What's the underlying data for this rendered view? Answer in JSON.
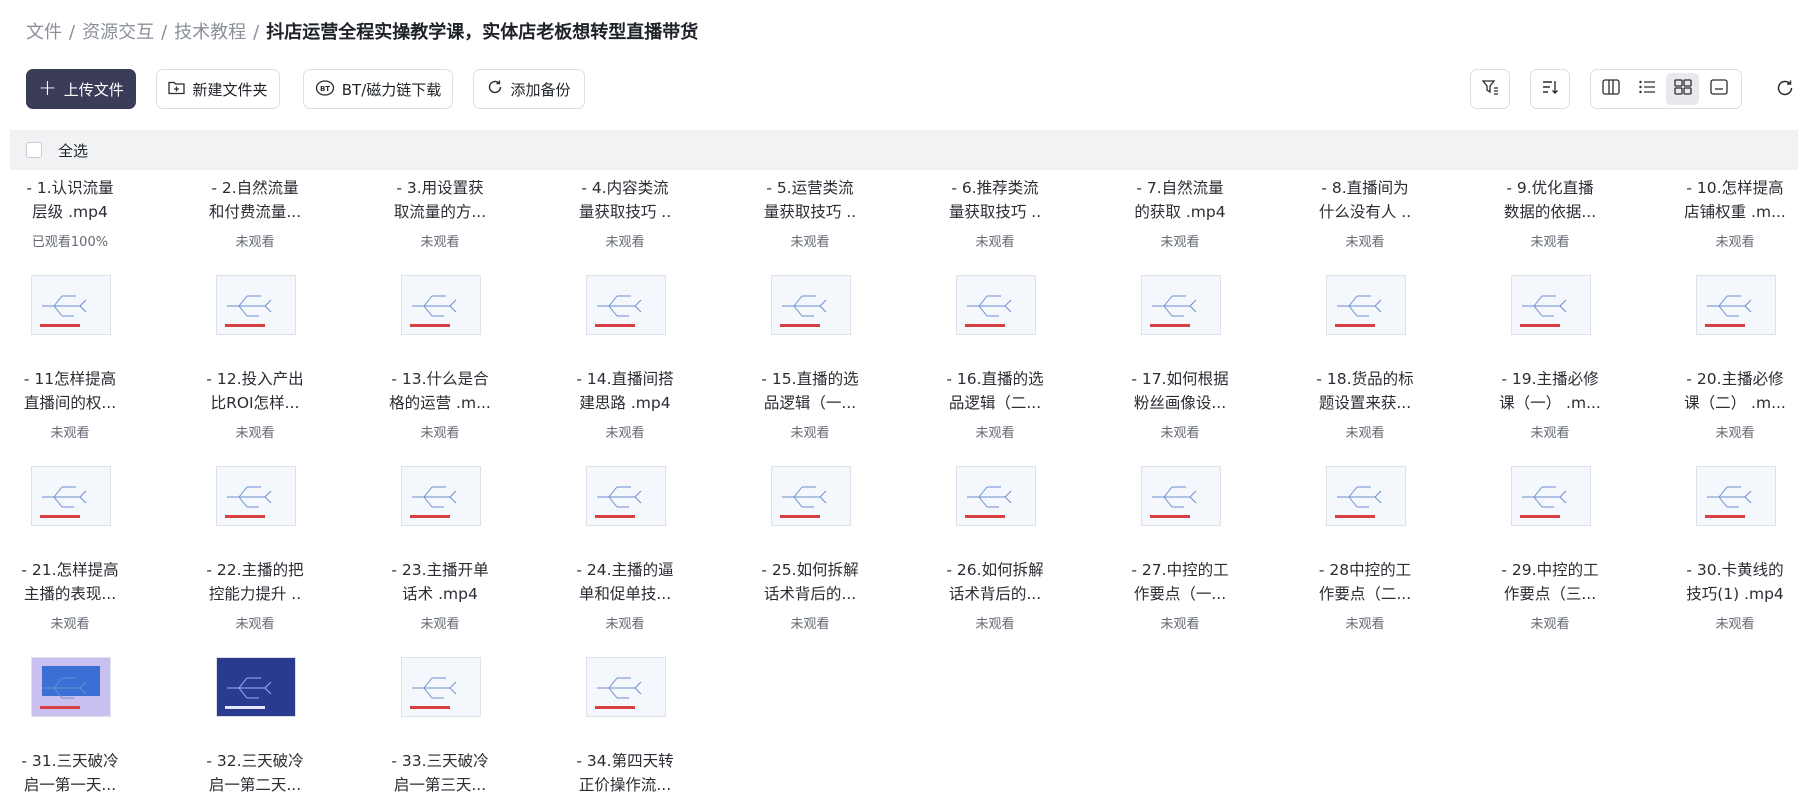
{
  "breadcrumb": {
    "items": [
      "文件",
      "资源交互",
      "技术教程"
    ],
    "current": "抖店运营全程实操教学课，实体店老板想转型直播带货"
  },
  "toolbar": {
    "upload": "上传文件",
    "new_folder": "新建文件夹",
    "bt_download": "BT/磁力链下载",
    "add_backup": "添加备份"
  },
  "select_all": "全选",
  "files": [
    {
      "line1": "- 1.认识流量",
      "line2": "层级 .mp4",
      "status": "已观看100%"
    },
    {
      "line1": "- 2.自然流量",
      "line2": "和付费流量...",
      "status": "未观看"
    },
    {
      "line1": "- 3.用设置获",
      "line2": "取流量的方...",
      "status": "未观看"
    },
    {
      "line1": "- 4.内容类流",
      "line2": "量获取技巧 ..",
      "status": "未观看"
    },
    {
      "line1": "- 5.运营类流",
      "line2": "量获取技巧 ..",
      "status": "未观看"
    },
    {
      "line1": "- 6.推荐类流",
      "line2": "量获取技巧 ..",
      "status": "未观看"
    },
    {
      "line1": "- 7.自然流量",
      "line2": "的获取 .mp4",
      "status": "未观看"
    },
    {
      "line1": "- 8.直播间为",
      "line2": "什么没有人 ..",
      "status": "未观看"
    },
    {
      "line1": "- 9.优化直播",
      "line2": "数据的依据...",
      "status": "未观看"
    },
    {
      "line1": "- 10.怎样提高",
      "line2": "店铺权重 .m...",
      "status": "未观看"
    },
    {
      "line1": "- 11怎样提高",
      "line2": "直播间的权...",
      "status": "未观看"
    },
    {
      "line1": "- 12.投入产出",
      "line2": "比ROI怎样...",
      "status": "未观看"
    },
    {
      "line1": "- 13.什么是合",
      "line2": "格的运营 .m...",
      "status": "未观看"
    },
    {
      "line1": "- 14.直播间搭",
      "line2": "建思路 .mp4",
      "status": "未观看"
    },
    {
      "line1": "- 15.直播的选",
      "line2": "品逻辑（一...",
      "status": "未观看"
    },
    {
      "line1": "- 16.直播的选",
      "line2": "品逻辑（二...",
      "status": "未观看"
    },
    {
      "line1": "- 17.如何根据",
      "line2": "粉丝画像设...",
      "status": "未观看"
    },
    {
      "line1": "- 18.货品的标",
      "line2": "题设置来获...",
      "status": "未观看"
    },
    {
      "line1": "- 19.主播必修",
      "line2": "课（一） .m...",
      "status": "未观看"
    },
    {
      "line1": "- 20.主播必修",
      "line2": "课（二） .m...",
      "status": "未观看"
    },
    {
      "line1": "- 21.怎样提高",
      "line2": "主播的表现...",
      "status": "未观看"
    },
    {
      "line1": "- 22.主播的把",
      "line2": "控能力提升 ..",
      "status": "未观看"
    },
    {
      "line1": "- 23.主播开单",
      "line2": "话术 .mp4",
      "status": "未观看"
    },
    {
      "line1": "- 24.主播的逼",
      "line2": "单和促单技...",
      "status": "未观看"
    },
    {
      "line1": "- 25.如何拆解",
      "line2": "话术背后的...",
      "status": "未观看"
    },
    {
      "line1": "- 26.如何拆解",
      "line2": "话术背后的...",
      "status": "未观看"
    },
    {
      "line1": "- 27.中控的工",
      "line2": "作要点（一...",
      "status": "未观看"
    },
    {
      "line1": "- 28中控的工",
      "line2": "作要点（二...",
      "status": "未观看"
    },
    {
      "line1": "- 29.中控的工",
      "line2": "作要点（三...",
      "status": "未观看"
    },
    {
      "line1": "- 30.卡黄线的",
      "line2": "技巧(1) .mp4",
      "status": "未观看"
    },
    {
      "line1": "- 31.三天破冷",
      "line2": "启一第一天...",
      "status": ""
    },
    {
      "line1": "- 32.三天破冷",
      "line2": "启一第二天...",
      "status": ""
    },
    {
      "line1": "- 33.三天破冷",
      "line2": "启一第三天...",
      "status": ""
    },
    {
      "line1": "- 34.第四天转",
      "line2": "正价操作流...",
      "status": ""
    }
  ]
}
